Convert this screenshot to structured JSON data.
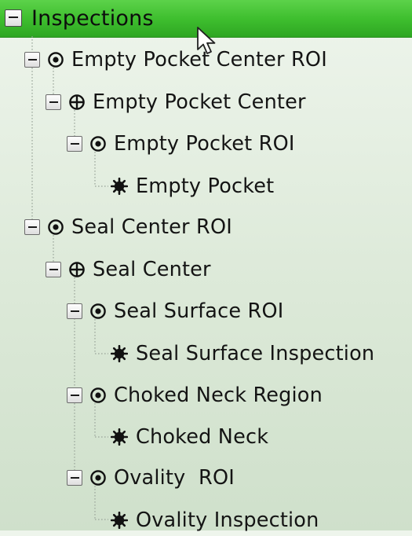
{
  "tree": {
    "root": {
      "label": "Inspections",
      "toggle_icon": "minus-icon",
      "bar_color": "#3fbf2f"
    },
    "nodes": [
      {
        "label": "Empty Pocket Center ROI",
        "icon": "roi-target-icon",
        "expandable": true
      },
      {
        "label": "Empty Pocket Center",
        "icon": "crosshair-center-icon",
        "expandable": true
      },
      {
        "label": "Empty Pocket ROI",
        "icon": "roi-target-icon",
        "expandable": true
      },
      {
        "label": "Empty Pocket",
        "icon": "inspection-gear-icon",
        "expandable": false
      },
      {
        "label": "Seal Center ROI",
        "icon": "roi-target-icon",
        "expandable": true
      },
      {
        "label": "Seal Center",
        "icon": "crosshair-center-icon",
        "expandable": true
      },
      {
        "label": "Seal Surface ROI",
        "icon": "roi-target-icon",
        "expandable": true
      },
      {
        "label": "Seal Surface Inspection",
        "icon": "inspection-gear-icon",
        "expandable": false
      },
      {
        "label": "Choked Neck Region",
        "icon": "roi-target-icon",
        "expandable": true
      },
      {
        "label": "Choked Neck",
        "icon": "inspection-gear-icon",
        "expandable": false
      },
      {
        "label": "Ovality  ROI",
        "icon": "roi-target-icon",
        "expandable": true
      },
      {
        "label": "Ovality Inspection",
        "icon": "inspection-gear-icon",
        "expandable": false
      }
    ]
  },
  "pointer": {
    "icon": "mouse-cursor-icon"
  }
}
